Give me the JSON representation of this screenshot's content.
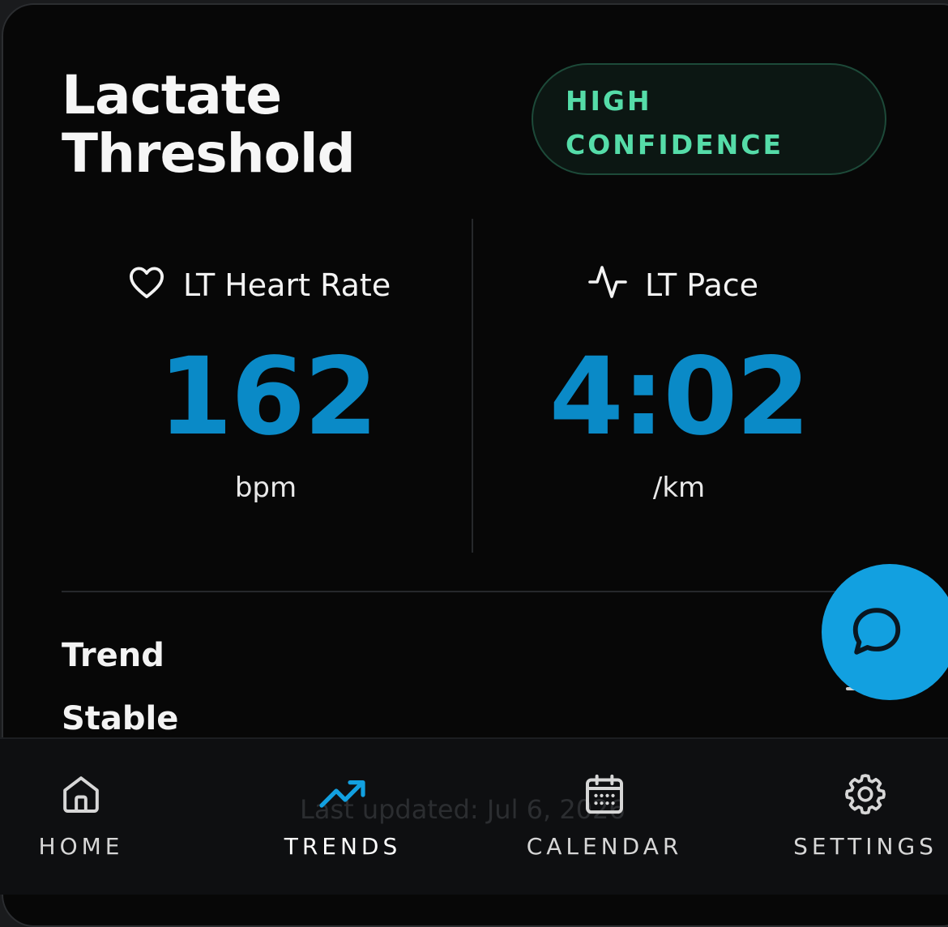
{
  "card": {
    "title_line1": "Lactate",
    "title_line2": "Threshold",
    "confidence_line1": "HIGH",
    "confidence_line2": "CONFIDENCE"
  },
  "metrics": {
    "heart_rate": {
      "label": "LT Heart Rate",
      "value": "162",
      "unit": "bpm",
      "icon": "heart-icon"
    },
    "pace": {
      "label": "LT Pace",
      "value": "4:02",
      "unit": "/km",
      "icon": "activity-pulse-icon"
    }
  },
  "trend": {
    "label": "Trend",
    "value": "Stable"
  },
  "last_updated": "Last updated: Jul 6, 2026",
  "fab": {
    "icon": "chat-bubble-icon"
  },
  "nav": {
    "items": [
      {
        "label": "HOME",
        "icon": "home-icon",
        "active": false
      },
      {
        "label": "TRENDS",
        "icon": "trending-up-icon",
        "active": true
      },
      {
        "label": "CALENDAR",
        "icon": "calendar-icon",
        "active": false
      },
      {
        "label": "SETTINGS",
        "icon": "gear-icon",
        "active": false
      }
    ]
  },
  "colors": {
    "accent": "#0a8ac7",
    "fab": "#12a0e0",
    "confidence_text": "#55dca8",
    "background": "#070707"
  }
}
